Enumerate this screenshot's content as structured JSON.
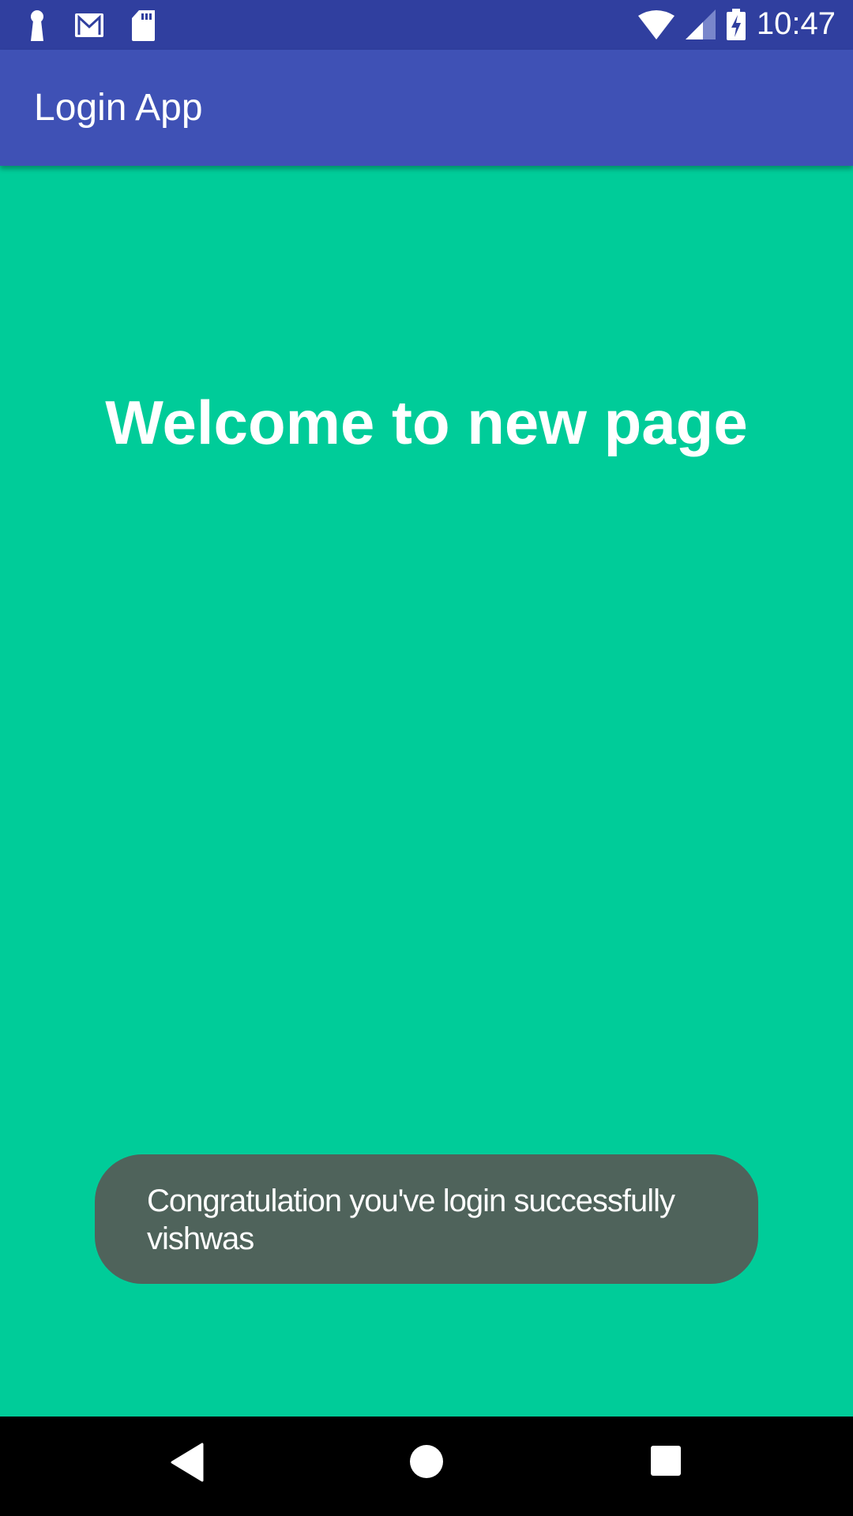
{
  "status_bar": {
    "time": "10:47",
    "left_icons": [
      "keyhole-icon",
      "gmail-icon",
      "sd-card-icon"
    ],
    "right_icons": [
      "wifi-icon",
      "cell-signal-icon",
      "battery-charging-icon"
    ]
  },
  "app_bar": {
    "title": "Login App"
  },
  "main": {
    "heading": "Welcome to new page"
  },
  "toast": {
    "message": "Congratulation you've login successfully vishwas"
  },
  "nav_bar": {
    "buttons": [
      "back",
      "home",
      "recents"
    ]
  },
  "colors": {
    "status_bar": "#303F9F",
    "app_bar": "#3F51B5",
    "background": "#00CC99",
    "toast": "#4F635B"
  }
}
